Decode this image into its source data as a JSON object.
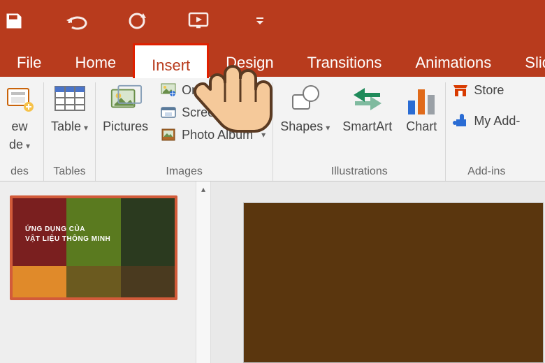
{
  "qat": {
    "undo": "↶",
    "redo": "↻",
    "present": "▣",
    "more": "▾"
  },
  "tabs": {
    "file": "File",
    "home": "Home",
    "insert": "Insert",
    "design": "Design",
    "transitions": "Transitions",
    "animations": "Animations",
    "slideshow": "Slide Show"
  },
  "ribbon": {
    "slides": {
      "new_top": "ew",
      "new_mid": "de",
      "footer": "des"
    },
    "tables": {
      "table": "Table",
      "footer": "Tables"
    },
    "images": {
      "pictures": "Pictures",
      "online": "Online",
      "screenshot": "Screenshot",
      "photo_album": "Photo Album",
      "footer": "Images"
    },
    "illustrations": {
      "shapes": "Shapes",
      "smartart": "SmartArt",
      "chart": "Chart",
      "footer": "Illustrations"
    },
    "addins": {
      "store": "Store",
      "myaddins": "My Add-",
      "footer": "Add-ins"
    }
  },
  "thumb": {
    "line1": "ỨNG DỤNG CỦA",
    "line2": "VẬT LIỆU THÔNG MINH"
  }
}
